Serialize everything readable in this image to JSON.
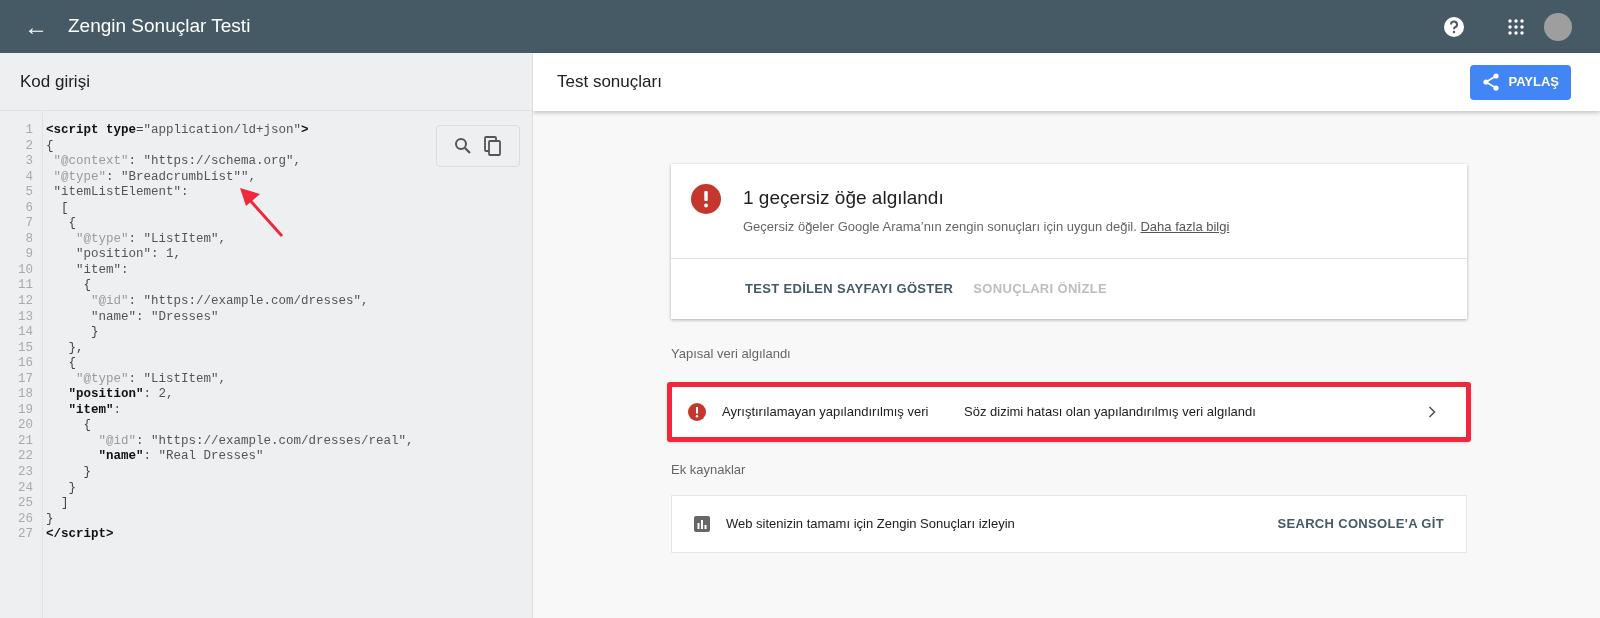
{
  "app_bar": {
    "back_icon": "←",
    "title": "Zengin Sonuçlar Testi"
  },
  "code_panel": {
    "title": "Kod girişi",
    "lines": [
      {
        "number": "1",
        "segments": [
          {
            "text": "<script type",
            "kind": "tag"
          },
          {
            "text": "=",
            "kind": "plain"
          },
          {
            "text": "\"application/ld+json\"",
            "kind": "value"
          },
          {
            "text": ">",
            "kind": "tag"
          }
        ]
      },
      {
        "number": "2",
        "segments": [
          {
            "text": "{",
            "kind": "plain"
          }
        ]
      },
      {
        "number": "3",
        "segments": [
          {
            "text": " \"@context\"",
            "kind": "key"
          },
          {
            "text": ": \"https://schema.org\",",
            "kind": "value"
          }
        ]
      },
      {
        "number": "4",
        "segments": [
          {
            "text": " \"@type\"",
            "kind": "key"
          },
          {
            "text": ": \"BreadcrumbList\"\",",
            "kind": "value"
          }
        ]
      },
      {
        "number": "5",
        "segments": [
          {
            "text": " \"itemListElement\":",
            "kind": "value"
          }
        ]
      },
      {
        "number": "6",
        "segments": [
          {
            "text": "  [",
            "kind": "plain"
          }
        ]
      },
      {
        "number": "7",
        "segments": [
          {
            "text": "   {",
            "kind": "plain"
          }
        ]
      },
      {
        "number": "8",
        "segments": [
          {
            "text": "    \"@type\"",
            "kind": "key"
          },
          {
            "text": ": \"ListItem\",",
            "kind": "value"
          }
        ]
      },
      {
        "number": "9",
        "segments": [
          {
            "text": "    \"position\": 1,",
            "kind": "value"
          }
        ]
      },
      {
        "number": "10",
        "segments": [
          {
            "text": "    \"item\":",
            "kind": "value"
          }
        ]
      },
      {
        "number": "11",
        "segments": [
          {
            "text": "     {",
            "kind": "plain"
          }
        ]
      },
      {
        "number": "12",
        "segments": [
          {
            "text": "      \"@id\"",
            "kind": "key"
          },
          {
            "text": ": \"https://example.com/dresses\",",
            "kind": "value"
          }
        ]
      },
      {
        "number": "13",
        "segments": [
          {
            "text": "      \"name\": \"Dresses\"",
            "kind": "value"
          }
        ]
      },
      {
        "number": "14",
        "segments": [
          {
            "text": "      }",
            "kind": "plain"
          }
        ]
      },
      {
        "number": "15",
        "segments": [
          {
            "text": "   },",
            "kind": "plain"
          }
        ]
      },
      {
        "number": "16",
        "segments": [
          {
            "text": "   {",
            "kind": "plain"
          }
        ]
      },
      {
        "number": "17",
        "segments": [
          {
            "text": "    \"@type\"",
            "kind": "key"
          },
          {
            "text": ": \"ListItem\",",
            "kind": "value"
          }
        ]
      },
      {
        "number": "18",
        "segments": [
          {
            "text": "   \"position\"",
            "kind": "tag"
          },
          {
            "text": ": 2,",
            "kind": "value"
          }
        ]
      },
      {
        "number": "19",
        "segments": [
          {
            "text": "   \"item\"",
            "kind": "tag"
          },
          {
            "text": ":",
            "kind": "value"
          }
        ]
      },
      {
        "number": "20",
        "segments": [
          {
            "text": "     {",
            "kind": "plain"
          }
        ]
      },
      {
        "number": "21",
        "segments": [
          {
            "text": "       \"@id\"",
            "kind": "key"
          },
          {
            "text": ": \"https://example.com/dresses/real\",",
            "kind": "value"
          }
        ]
      },
      {
        "number": "22",
        "segments": [
          {
            "text": "       \"name\"",
            "kind": "tag"
          },
          {
            "text": ": \"Real Dresses\"",
            "kind": "value"
          }
        ]
      },
      {
        "number": "23",
        "segments": [
          {
            "text": "     }",
            "kind": "plain"
          }
        ]
      },
      {
        "number": "24",
        "segments": [
          {
            "text": "   }",
            "kind": "plain"
          }
        ]
      },
      {
        "number": "25",
        "segments": [
          {
            "text": "  ]",
            "kind": "plain"
          }
        ]
      },
      {
        "number": "26",
        "segments": [
          {
            "text": "}",
            "kind": "plain"
          }
        ]
      },
      {
        "number": "27",
        "segments": [
          {
            "text": "</script>",
            "kind": "tag"
          }
        ]
      }
    ]
  },
  "results": {
    "title": "Test sonuçları",
    "share_button": "PAYLAŞ",
    "summary": {
      "title": "1 geçersiz öğe algılandı",
      "description": "Geçersiz öğeler Google Arama’nın zengin sonuçları için uygun değil.",
      "link": "Daha fazla bilgi",
      "actions": [
        {
          "label": "TEST EDİLEN SAYFAYI GÖSTER",
          "disabled": false
        },
        {
          "label": "SONUÇLARI ÖNİZLE",
          "disabled": true
        }
      ]
    },
    "structured_heading": "Yapısal veri algılandı",
    "structured_items": [
      {
        "name": "Ayrıştırılamayan yapılandırılmış veri",
        "detail": "Söz dizimi hatası olan yapılandırılmış veri algılandı",
        "highlighted": true
      }
    ],
    "resources_heading": "Ek kaynaklar",
    "resources": [
      {
        "text": "Web sitenizin tamamı için Zengin Sonuçları izleyin",
        "action": "SEARCH CONSOLE'A GİT"
      }
    ]
  }
}
